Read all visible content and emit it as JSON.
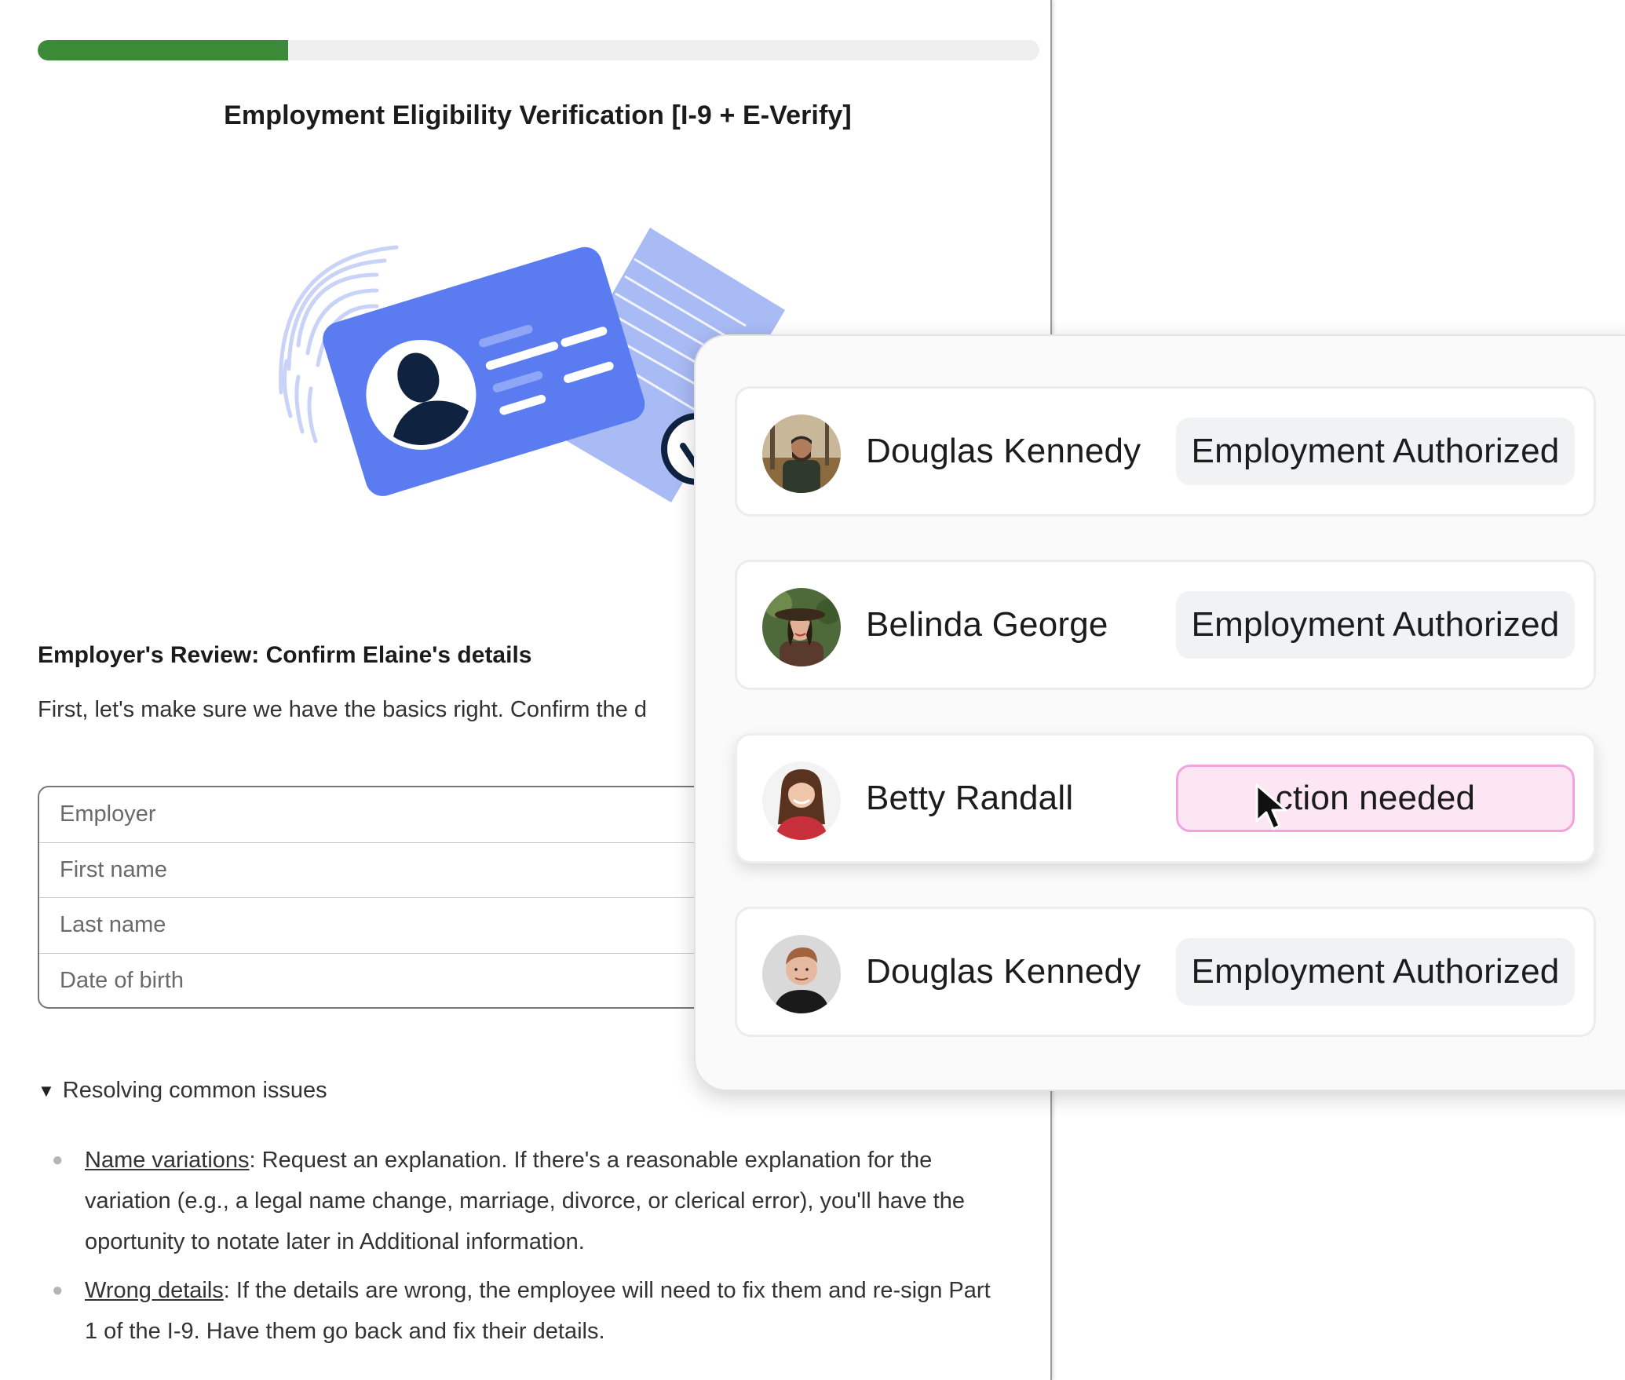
{
  "progress": {
    "fraction": 0.25
  },
  "form": {
    "title": "Employment Eligibility Verification [I-9 + E-Verify]",
    "review_heading": "Employer's Review: Confirm Elaine's details",
    "review_text": "First, let's make sure we have the basics right. Confirm the d",
    "fields": [
      {
        "label": "Employer"
      },
      {
        "label": "First name"
      },
      {
        "label": "Last name"
      },
      {
        "label": "Date of birth"
      }
    ],
    "issues_toggle": "Resolving common issues",
    "issues": [
      {
        "term": "Name variations",
        "text": ": Request an explanation. If there's a reasonable explanation for the variation (e.g., a legal name change, marriage, divorce, or clerical error), you'll have the oportunity to notate later in Additional information."
      },
      {
        "term": "Wrong details",
        "text": ": If the details are wrong, the employee will need to fix them and re-sign Part 1 of the I-9. Have them go back and fix their details."
      }
    ]
  },
  "employees": [
    {
      "name": "Douglas Kennedy",
      "status": "Employment Authorized",
      "state": "authorized"
    },
    {
      "name": "Belinda George",
      "status": "Employment Authorized",
      "state": "authorized"
    },
    {
      "name": "Betty Randall",
      "status": "ction needed",
      "state": "action"
    },
    {
      "name": "Douglas Kennedy",
      "status": "Employment Authorized",
      "state": "authorized"
    }
  ],
  "colors": {
    "progress": "#3a8a37",
    "card_blue": "#5b7cf0",
    "doc_blue": "#a9bbf5",
    "navy": "#0f2340",
    "action_bg": "#fde6f4",
    "action_border": "#f2a3dd",
    "pill_bg": "#f1f2f4"
  },
  "icons": [
    "id-card-illustration",
    "fingerprint-icon",
    "person-silhouette-icon",
    "document-icon",
    "checkmark-seal-icon",
    "mouse-cursor-icon"
  ]
}
